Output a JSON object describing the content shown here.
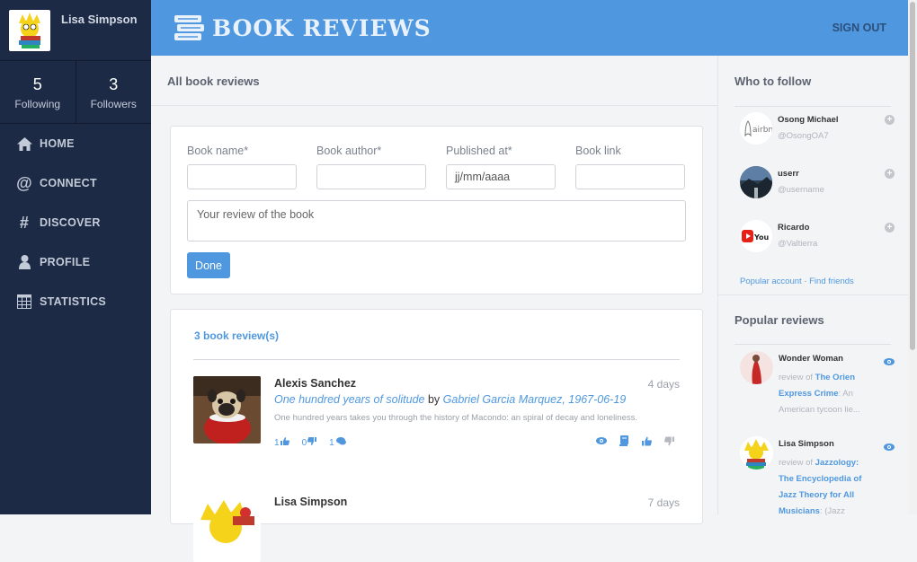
{
  "user": {
    "name": "Lisa Simpson"
  },
  "stats": [
    {
      "value": "5",
      "label": "Following"
    },
    {
      "value": "3",
      "label": "Followers"
    }
  ],
  "nav": [
    {
      "label": "HOME",
      "icon": "home-icon"
    },
    {
      "label": "CONNECT",
      "icon": "at-icon"
    },
    {
      "label": "DISCOVER",
      "icon": "hashtag-icon"
    },
    {
      "label": "PROFILE",
      "icon": "user-icon"
    },
    {
      "label": "STATISTICS",
      "icon": "table-icon"
    }
  ],
  "header": {
    "logo_text": "BOOK REVIEWS",
    "signout": "SIGN OUT",
    "logo_icon": "books-icon"
  },
  "main": {
    "title": "All book reviews"
  },
  "form": {
    "book_name_label": "Book name*",
    "book_author_label": "Book author*",
    "published_label": "Published at*",
    "link_label": "Book link",
    "published_value": "jj/mm/aaaa",
    "review_placeholder": "Your review of the book",
    "done_label": "Done"
  },
  "reviews": {
    "count_label": "3 book review(s)",
    "items": [
      {
        "author": "Alexis Sanchez",
        "time": "4 days",
        "book_title": "One hundred years of solitude",
        "by_word": "by",
        "book_author": "Gabriel Garcia Marquez",
        "date": "1967-06-19",
        "description": "One hundred years takes you through the history of Macondo: an spiral of decay and loneliness.",
        "likes": "1",
        "dislikes": "0",
        "comments": "1"
      },
      {
        "author": "Lisa Simpson",
        "time": "7 days"
      }
    ]
  },
  "who_to_follow": {
    "title": "Who to follow",
    "items": [
      {
        "name": "Osong Michael",
        "handle": "@OsongOA7"
      },
      {
        "name": "userr",
        "handle": "@username"
      },
      {
        "name": "Ricardo",
        "handle": "@Valtierra"
      }
    ],
    "link_popular": "Popular account",
    "link_sep": "·",
    "link_friends": "Find friends"
  },
  "popular_reviews": {
    "title": "Popular reviews",
    "items": [
      {
        "name": "Wonder Woman",
        "prefix": "review of",
        "book": "The Orien Express Crime",
        "excerpt": ": An American tycoon lie..."
      },
      {
        "name": "Lisa Simpson",
        "prefix": "review of",
        "book": "Jazzology: The Encyclopedia of Jazz Theory for All Musicians",
        "excerpt": ": (Jazz"
      }
    ]
  },
  "colors": {
    "accent": "#4f98e0",
    "sidebar": "#1d2a45"
  }
}
